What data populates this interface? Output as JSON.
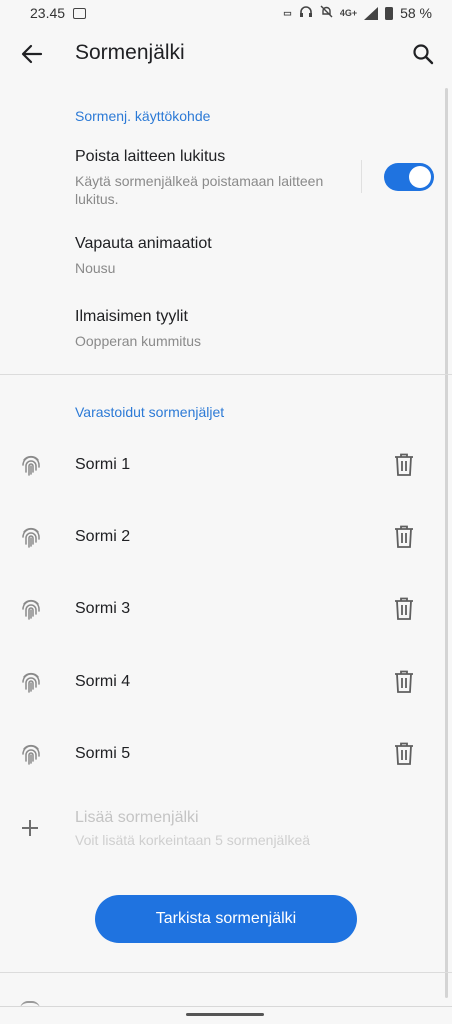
{
  "status_bar": {
    "time": "23.45",
    "network": "4G+",
    "battery": "58 %"
  },
  "header": {
    "title": "Sormenjälki"
  },
  "section_usage": {
    "header": "Sormenj. käyttökohde",
    "unlock": {
      "title": "Poista laitteen lukitus",
      "summary": "Käytä sormenjälkeä poistamaan laitteen lukitus.",
      "enabled": true
    },
    "animation": {
      "title": "Vapauta animaatiot",
      "summary": "Nousu"
    },
    "indicator": {
      "title": "Ilmaisimen tyylit",
      "summary": "Oopperan kummitus"
    }
  },
  "section_saved": {
    "header": "Varastoidut sormenjäljet",
    "fingers": [
      {
        "name": "Sormi 1"
      },
      {
        "name": "Sormi 2"
      },
      {
        "name": "Sormi 3"
      },
      {
        "name": "Sormi 4"
      },
      {
        "name": "Sormi 5"
      }
    ],
    "add": {
      "title": "Lisää sormenjälki",
      "summary": "Voit lisätä korkeintaan 5 sormenjälkeä"
    }
  },
  "verify_button": {
    "label": "Tarkista sormenjälki"
  },
  "colors": {
    "accent": "#1f73e0",
    "section_header": "#2c7ad6"
  },
  "icons": [
    "back-arrow-icon",
    "search-icon",
    "fingerprint-icon",
    "trash-icon",
    "plus-icon"
  ]
}
